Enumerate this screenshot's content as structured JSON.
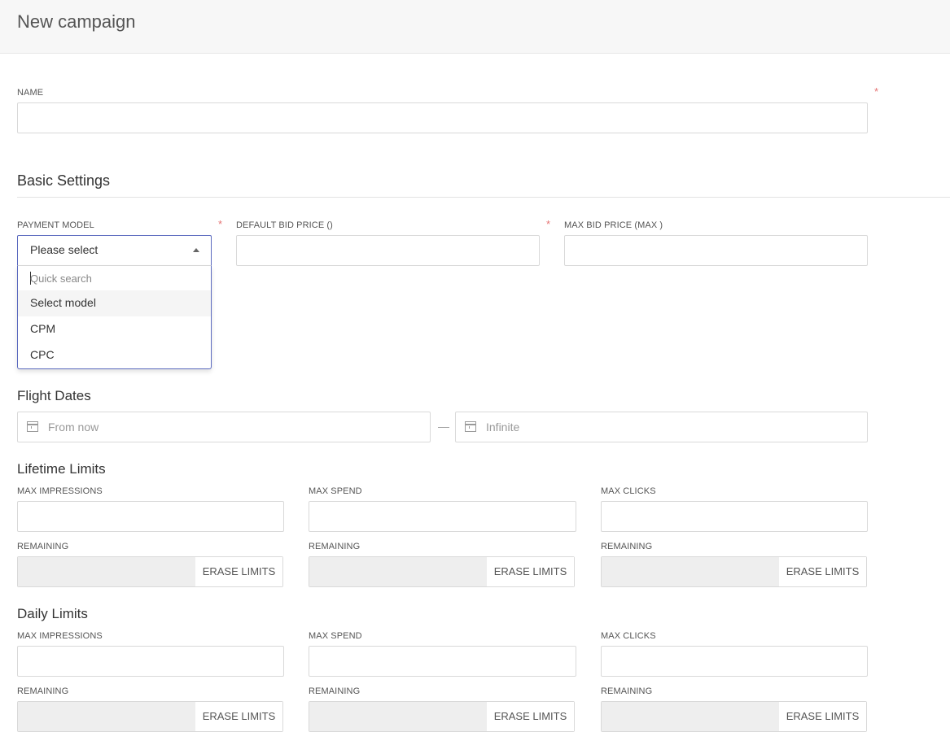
{
  "page": {
    "title": "New campaign"
  },
  "name_field": {
    "label": "NAME",
    "required_mark": "*",
    "value": ""
  },
  "basic_settings": {
    "heading": "Basic Settings",
    "payment_model": {
      "label": "PAYMENT MODEL",
      "required_mark": "*",
      "selected": "Please select",
      "dropdown": {
        "search_placeholder": "Quick search",
        "options": [
          "Select model",
          "CPM",
          "CPC"
        ],
        "highlighted_index": 0
      }
    },
    "default_bid": {
      "label": "DEFAULT BID PRICE ()",
      "required_mark": "*",
      "value": ""
    },
    "max_bid": {
      "label": "MAX BID PRICE (MAX )",
      "value": ""
    }
  },
  "flight_dates": {
    "heading": "Flight Dates",
    "from_placeholder": "From now",
    "separator": "—",
    "to_placeholder": "Infinite",
    "icon": "calendar-icon"
  },
  "lifetime_limits": {
    "heading": "Lifetime Limits",
    "fields": [
      {
        "label": "MAX IMPRESSIONS",
        "value": ""
      },
      {
        "label": "MAX SPEND",
        "value": ""
      },
      {
        "label": "MAX CLICKS",
        "value": ""
      }
    ],
    "remaining_label": "REMAINING",
    "erase_label": "ERASE LIMITS"
  },
  "daily_limits": {
    "heading": "Daily Limits",
    "fields": [
      {
        "label": "MAX IMPRESSIONS",
        "value": ""
      },
      {
        "label": "MAX SPEND",
        "value": ""
      },
      {
        "label": "MAX CLICKS",
        "value": ""
      }
    ],
    "remaining_label": "REMAINING",
    "erase_label": "ERASE LIMITS"
  },
  "colors": {
    "accent": "#5b6abf",
    "required": "#e57373",
    "header_bg": "#f7f7f7"
  }
}
